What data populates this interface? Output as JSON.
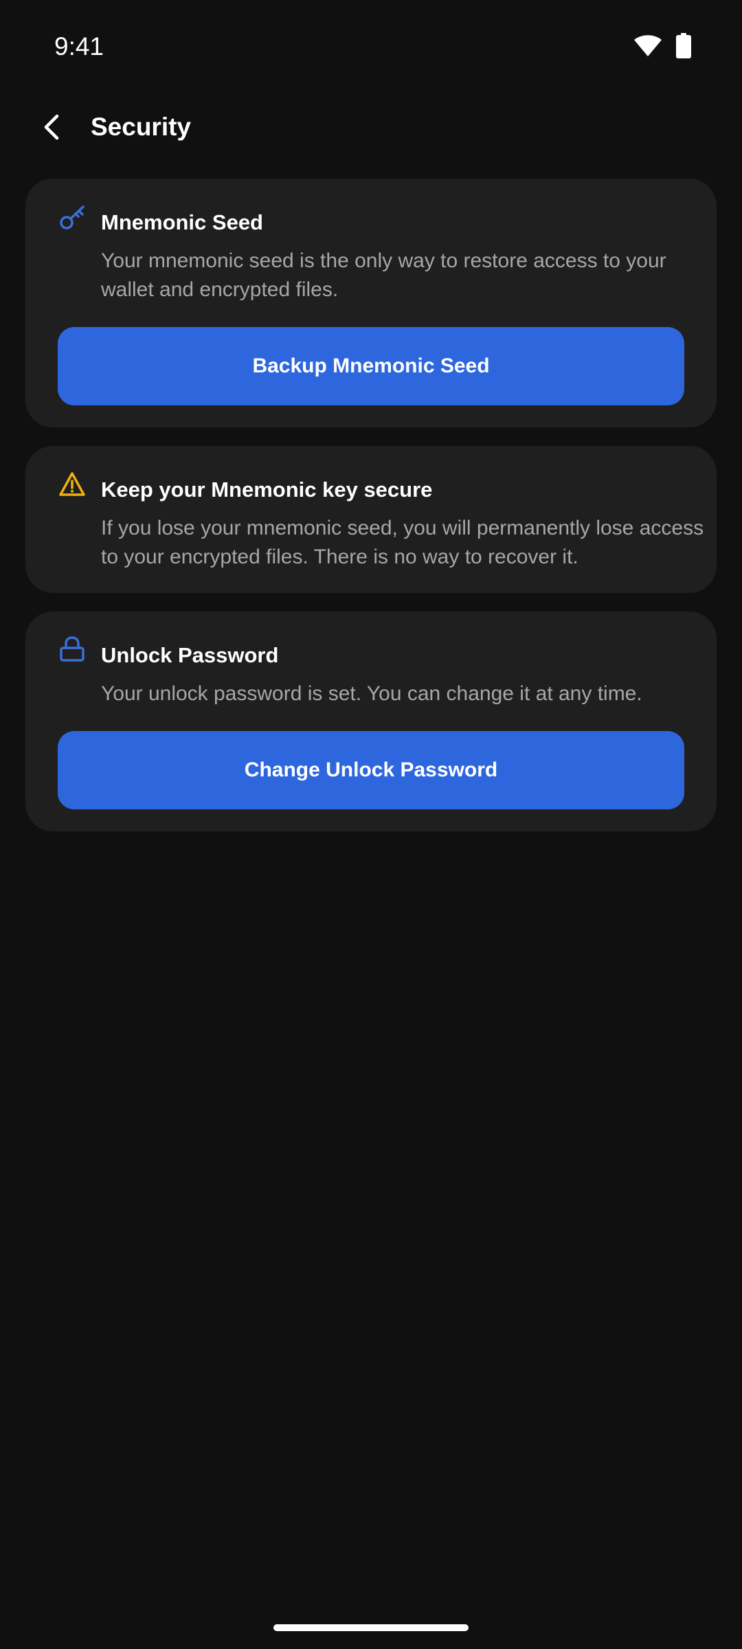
{
  "status_bar": {
    "time": "9:41",
    "icons": [
      "wifi-icon",
      "battery-icon"
    ]
  },
  "app_bar": {
    "back_icon": "chevron-left-icon",
    "title": "Security"
  },
  "cards": {
    "mnemonic_seed": {
      "icon": "key-icon",
      "title": "Mnemonic Seed",
      "description": "Your mnemonic seed is the only way to restore access to your wallet and encrypted files.",
      "button_label": "Backup Mnemonic Seed"
    },
    "warning": {
      "icon": "warning-icon",
      "title": "Keep your Mnemonic key secure",
      "description": "If you lose your mnemonic seed, you will permanently lose access to your encrypted files. There is no way to recover it."
    },
    "unlock_password": {
      "icon": "lock-icon",
      "title": "Unlock Password",
      "description": "Your unlock password is set. You can change it at any time.",
      "button_label": "Change Unlock Password"
    }
  },
  "colors": {
    "background": "#101010",
    "card_background": "#1f1f1f",
    "primary_button": "#2e67dd",
    "accent_icon": "#3b6fdc",
    "warning_icon": "#f0b10e",
    "secondary_text": "#a7a7a7"
  }
}
